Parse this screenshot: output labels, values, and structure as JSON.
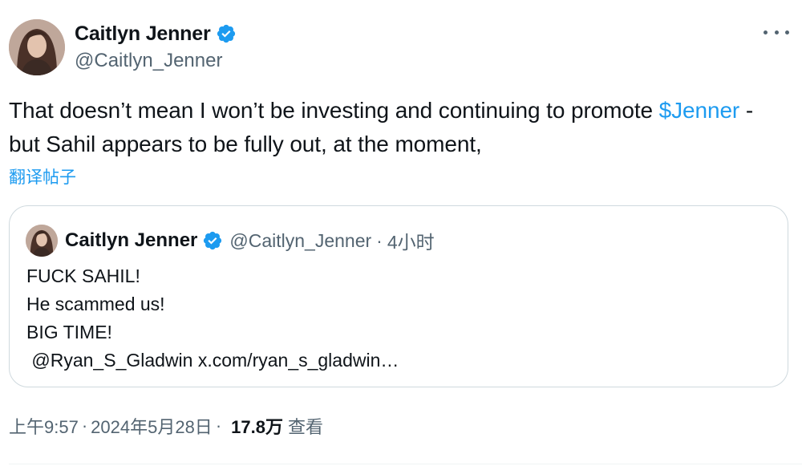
{
  "author": {
    "display_name": "Caitlyn Jenner",
    "handle": "@Caitlyn_Jenner"
  },
  "tweet": {
    "text_before": "That doesn’t mean I won’t be investing and continuing to promote ",
    "cashtag": "$Jenner",
    "text_after": " - but Sahil appears to be fully out, at the moment,",
    "translate_label": "翻译帖子"
  },
  "quote": {
    "display_name": "Caitlyn Jenner",
    "handle": "@Caitlyn_Jenner",
    "separator": "·",
    "time": "4小时",
    "lines": [
      "FUCK SAHIL!",
      "He scammed us!",
      "BIG TIME!",
      " @Ryan_S_Gladwin x.com/ryan_s_gladwin…"
    ]
  },
  "footer": {
    "time": "上午9:57",
    "separator": "·",
    "date": "2024年5月28日",
    "views_count": "17.8万",
    "views_label": "查看"
  },
  "icons": {
    "verified": "verified-badge-icon",
    "more": "more-options-icon"
  },
  "colors": {
    "accent": "#1d9bf0",
    "text": "#0f1419",
    "secondary": "#536471",
    "border": "#cfd9de"
  }
}
